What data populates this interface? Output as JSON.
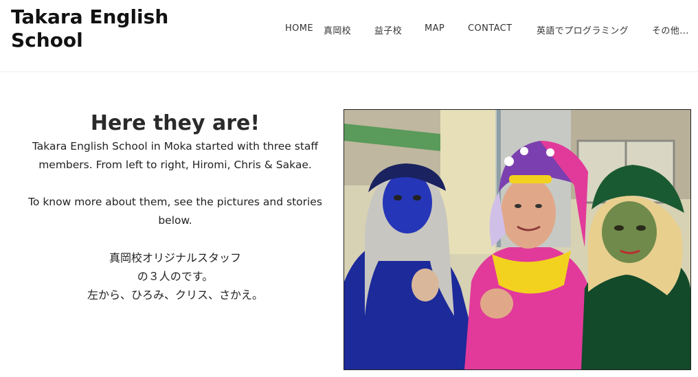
{
  "site": {
    "title": "Takara English School"
  },
  "nav": {
    "items": [
      {
        "label": "HOME"
      },
      {
        "label": "真岡校"
      },
      {
        "label": "益子校"
      },
      {
        "label": "MAP"
      },
      {
        "label": "CONTACT"
      },
      {
        "label": "英語でプログラミング"
      },
      {
        "label": "その他..."
      }
    ]
  },
  "main": {
    "heading": "Here they are!",
    "intro_line1": "Takara English School in Moka started with three staff",
    "intro_line2": "members. From left to right, Hiromi, Chris & Sakae.",
    "more_line1": "To know more about them, see the pictures and stories",
    "more_line2": "below.",
    "jp_line1": "真岡校オリジナルスタッフ",
    "jp_line2": "の３人のです。",
    "jp_line3": "左から、ひろみ、クリス、さかえ。"
  }
}
